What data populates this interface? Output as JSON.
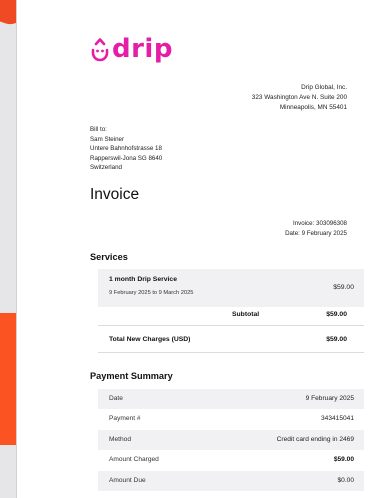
{
  "brand": {
    "name": "drip",
    "color": "#e51ea8",
    "accent_left": "#f04a25",
    "accent_card": "#fb5322"
  },
  "company": {
    "name": "Drip Global, Inc.",
    "address_line1": "323 Washington Ave N. Suite 200",
    "address_line2": "Minneapolis, MN 55401"
  },
  "bill_to": {
    "label": "Bill to:",
    "name": "Sam Steiner",
    "street": "Untere Bahnhofstrasse 18",
    "city": "Rapperswil-Jona SG 8640",
    "country": "Switzerland"
  },
  "invoice": {
    "title": "Invoice",
    "number_line": "Invoice: 303096308",
    "date_line": "Date: 9 February 2025"
  },
  "services": {
    "heading": "Services",
    "item_name": "1 month Drip Service",
    "item_dates": "9 February 2025 to 9 March 2025",
    "item_amount": "$59.00",
    "subtotal_label": "Subtotal",
    "subtotal_amount": "$59.00",
    "total_label": "Total New Charges (USD)",
    "total_amount": "$59.00"
  },
  "payment": {
    "heading": "Payment Summary",
    "rows": [
      {
        "label": "Date",
        "value": "9 February 2025"
      },
      {
        "label": "Payment #",
        "value": "343415041"
      },
      {
        "label": "Method",
        "value": "Credit card ending in 2469"
      },
      {
        "label": "Amount Charged",
        "value": "$59.00"
      },
      {
        "label": "Amount Due",
        "value": "$0.00"
      }
    ]
  }
}
